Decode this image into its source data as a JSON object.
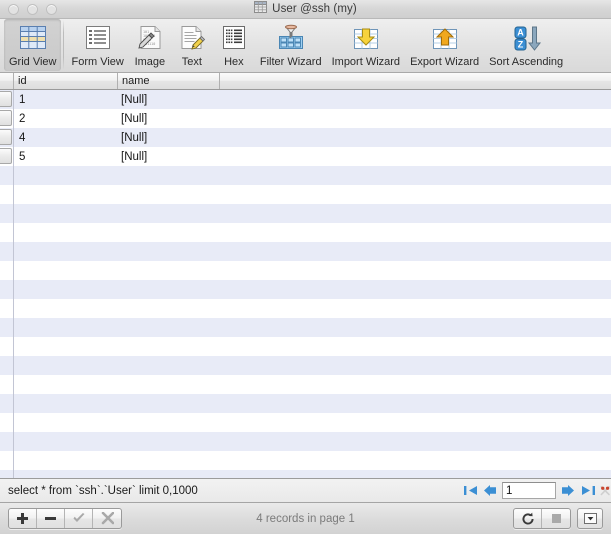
{
  "window": {
    "title": "User @ssh (my)",
    "title_icon": "grid-table-icon",
    "traffic_lights": [
      "close-button",
      "minimize-button",
      "zoom-button"
    ]
  },
  "toolbar": {
    "items": [
      {
        "label": "Grid View",
        "icon": "grid-view-icon",
        "selected": true
      },
      {
        "label": "Form View",
        "icon": "form-view-icon",
        "selected": false
      },
      {
        "label": "Image",
        "icon": "image-icon",
        "selected": false
      },
      {
        "label": "Text",
        "icon": "text-icon",
        "selected": false
      },
      {
        "label": "Hex",
        "icon": "hex-icon",
        "selected": false
      },
      {
        "label": "Filter Wizard",
        "icon": "filter-wizard-icon",
        "selected": false
      },
      {
        "label": "Import Wizard",
        "icon": "import-wizard-icon",
        "selected": false
      },
      {
        "label": "Export Wizard",
        "icon": "export-wizard-icon",
        "selected": false
      },
      {
        "label": "Sort Ascending",
        "icon": "sort-ascending-icon",
        "selected": false
      }
    ]
  },
  "grid": {
    "columns": [
      "id",
      "name"
    ],
    "rows": [
      {
        "id": "1",
        "name": "[Null]"
      },
      {
        "id": "2",
        "name": "[Null]"
      },
      {
        "id": "4",
        "name": "[Null]"
      },
      {
        "id": "5",
        "name": "[Null]"
      }
    ],
    "empty_row_count": 17
  },
  "query_bar": {
    "query": "select * from `ssh`.`User`  limit 0,1000",
    "page_value": "1",
    "buttons": [
      "first-page-button",
      "previous-page-button",
      "next-page-button",
      "last-page-button",
      "stop-query-button"
    ]
  },
  "status_bar": {
    "record_status": "4 records in page 1",
    "left_buttons": [
      {
        "name": "add-record-button",
        "icon": "plus-icon",
        "enabled": true
      },
      {
        "name": "delete-record-button",
        "icon": "minus-icon",
        "enabled": true
      },
      {
        "name": "apply-changes-button",
        "icon": "checkmark-icon",
        "enabled": false
      },
      {
        "name": "cancel-changes-button",
        "icon": "x-icon",
        "enabled": false
      }
    ],
    "right_buttons": [
      {
        "name": "refresh-button",
        "icon": "refresh-icon",
        "enabled": true
      },
      {
        "name": "stop-button",
        "icon": "stop-square-icon",
        "enabled": false
      },
      {
        "name": "options-button",
        "icon": "chevron-down-icon",
        "enabled": true
      }
    ]
  },
  "colors": {
    "row_stripe": "#e8ebf7",
    "row_plain": "#ffffff",
    "toolbar_bg": "#e2e2e2",
    "accent_blue": "#3b8fd4"
  }
}
